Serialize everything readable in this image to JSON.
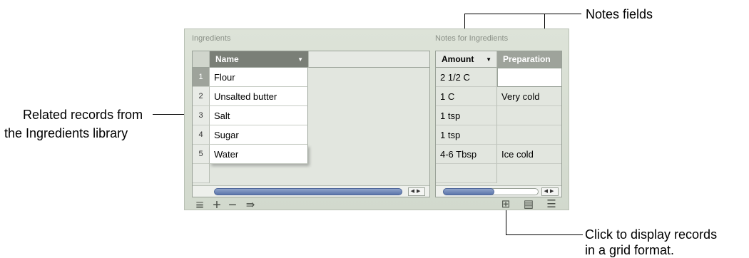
{
  "callouts": {
    "notes_fields": "Notes fields",
    "related_records_line1": "Related records from",
    "related_records_line2": "the Ingredients library",
    "grid_format_line1": "Click to display records",
    "grid_format_line2": "in a grid format."
  },
  "ingredients": {
    "section_label": "Ingredients",
    "column_header": "Name",
    "rows": [
      {
        "num": "1",
        "name": "Flour"
      },
      {
        "num": "2",
        "name": "Unsalted butter"
      },
      {
        "num": "3",
        "name": "Salt"
      },
      {
        "num": "4",
        "name": "Sugar"
      },
      {
        "num": "5",
        "name": "Water"
      }
    ]
  },
  "notes": {
    "section_label": "Notes for Ingredients",
    "amount_header": "Amount",
    "preparation_header": "Preparation",
    "rows": [
      {
        "amount": "2 1/2 C",
        "preparation": ""
      },
      {
        "amount": "1 C",
        "preparation": "Very cold"
      },
      {
        "amount": "1 tsp",
        "preparation": ""
      },
      {
        "amount": "1 tsp",
        "preparation": ""
      },
      {
        "amount": "4-6 Tbsp",
        "preparation": "Ice cold"
      }
    ]
  },
  "toolbar": {
    "left_icons": [
      "add-records-icon",
      "plus-icon",
      "minus-icon",
      "export-icon"
    ],
    "right_icons": [
      "grid-view-icon",
      "card-view-icon",
      "list-view-icon"
    ]
  },
  "colors": {
    "selected_header": "#7a7f77",
    "preparation_header": "#9ea39b",
    "panel_bg": "#d8ded3"
  }
}
